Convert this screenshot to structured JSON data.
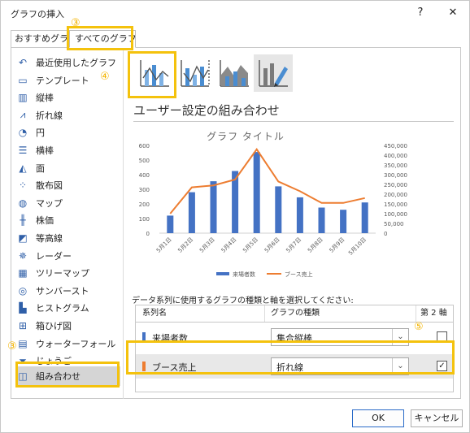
{
  "window": {
    "title": "グラフの挿入",
    "help_label": "?",
    "close_label": "✕"
  },
  "tabs": [
    {
      "label": "おすすめグラフ"
    },
    {
      "label": "すべてのグラフ"
    }
  ],
  "callouts": {
    "tab": "③",
    "combo": "③",
    "chart_type": "④",
    "axis": "⑤"
  },
  "sidebar": {
    "items": [
      {
        "label": "最近使用したグラフ",
        "icon": "undo-icon"
      },
      {
        "label": "テンプレート",
        "icon": "folder-icon"
      },
      {
        "label": "縦棒",
        "icon": "column-chart-icon"
      },
      {
        "label": "折れ線",
        "icon": "line-chart-icon"
      },
      {
        "label": "円",
        "icon": "pie-chart-icon"
      },
      {
        "label": "横棒",
        "icon": "bar-chart-icon"
      },
      {
        "label": "面",
        "icon": "area-chart-icon"
      },
      {
        "label": "散布図",
        "icon": "scatter-chart-icon"
      },
      {
        "label": "マップ",
        "icon": "map-chart-icon"
      },
      {
        "label": "株価",
        "icon": "stock-chart-icon"
      },
      {
        "label": "等高線",
        "icon": "surface-chart-icon"
      },
      {
        "label": "レーダー",
        "icon": "radar-chart-icon"
      },
      {
        "label": "ツリーマップ",
        "icon": "treemap-icon"
      },
      {
        "label": "サンバースト",
        "icon": "sunburst-icon"
      },
      {
        "label": "ヒストグラム",
        "icon": "histogram-icon"
      },
      {
        "label": "箱ひげ図",
        "icon": "box-whisker-icon"
      },
      {
        "label": "ウォーターフォール",
        "icon": "waterfall-icon"
      },
      {
        "label": "じょうご",
        "icon": "funnel-icon"
      },
      {
        "label": "組み合わせ",
        "icon": "combo-chart-icon"
      }
    ],
    "selected": "組み合わせ"
  },
  "main": {
    "subtitle": "ユーザー設定の組み合わせ",
    "question": "データ系列に使用するグラフの種類と軸を選択してください:",
    "grid": {
      "headers": {
        "name": "系列名",
        "type": "グラフの種類",
        "axis": "第 2 軸"
      },
      "rows": [
        {
          "name": "来場者数",
          "color": "#4472c4",
          "type": "集合縦棒",
          "secondary": false,
          "check": ""
        },
        {
          "name": "ブース売上",
          "color": "#ed7d31",
          "type": "折れ線",
          "secondary": true,
          "check": "✓"
        }
      ]
    }
  },
  "chart_data": {
    "type": "bar",
    "title": "グラフ タイトル",
    "categories": [
      "5月1日",
      "5月2日",
      "5月3日",
      "5月4日",
      "5月5日",
      "5月6日",
      "5月7日",
      "5月8日",
      "5月9日",
      "5月10日"
    ],
    "series": [
      {
        "name": "来場者数",
        "type": "bar",
        "axis": "primary",
        "color": "#4472c4",
        "values": [
          120,
          280,
          355,
          425,
          555,
          320,
          245,
          175,
          160,
          210
        ]
      },
      {
        "name": "ブース売上",
        "type": "line",
        "axis": "secondary",
        "color": "#ed7d31",
        "values": [
          100000,
          235000,
          245000,
          275000,
          430000,
          265000,
          215000,
          155000,
          155000,
          180000
        ]
      }
    ],
    "ylim": [
      0,
      600
    ],
    "y2lim": [
      0,
      450000
    ],
    "yticks": [
      "0",
      "100",
      "200",
      "300",
      "400",
      "500",
      "600"
    ],
    "y2ticks": [
      "0",
      "50,000",
      "100,000",
      "150,000",
      "200,000",
      "250,000",
      "300,000",
      "350,000",
      "400,000",
      "450,000"
    ],
    "legend_position": "bottom",
    "grid": false
  },
  "footer": {
    "ok_label": "OK",
    "cancel_label": "キャンセル"
  },
  "colors": {
    "highlight": "#f4c20d",
    "accent": "#2a6bc8"
  }
}
